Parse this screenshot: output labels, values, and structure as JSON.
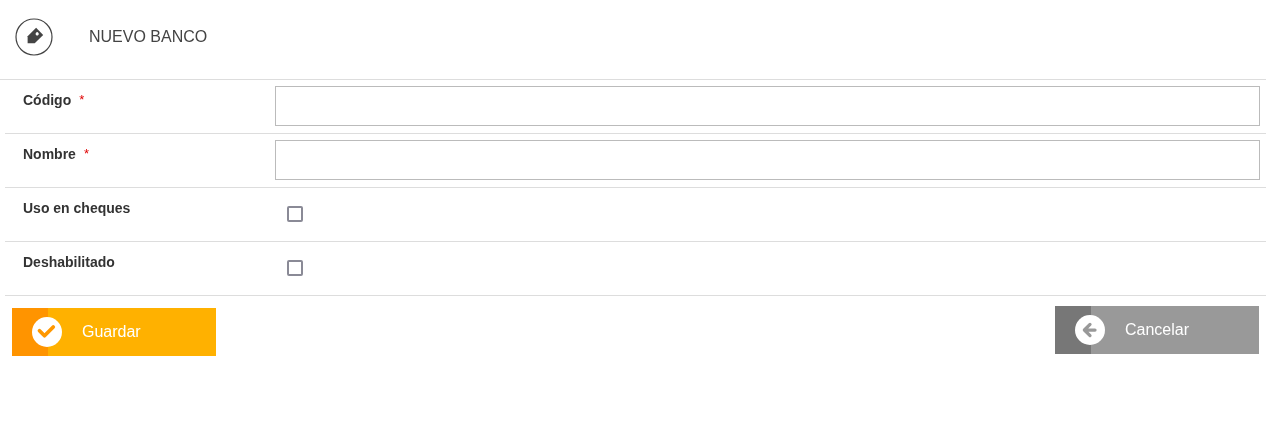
{
  "header": {
    "title": "NUEVO BANCO"
  },
  "fields": [
    {
      "kind": "text",
      "label": "Código",
      "required_mark": "*"
    },
    {
      "kind": "text",
      "label": "Nombre",
      "required_mark": "*"
    },
    {
      "kind": "checkbox",
      "label": "Uso en cheques",
      "checked": false
    },
    {
      "kind": "checkbox",
      "label": "Deshabilitado",
      "checked": false
    }
  ],
  "buttons": [
    {
      "kind": "confirm",
      "label": "Guardar"
    },
    {
      "kind": "cancel",
      "label": "Cancelar"
    }
  ]
}
